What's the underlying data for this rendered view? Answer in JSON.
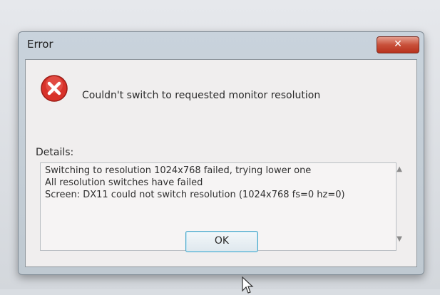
{
  "window": {
    "title": "Error",
    "close_label": "✕"
  },
  "dialog": {
    "message": "Couldn't switch to requested monitor resolution",
    "details_label": "Details:",
    "details_text": "Switching to resolution 1024x768 failed, trying lower one\nAll resolution switches have failed\nScreen: DX11 could not switch resolution (1024x768 fs=0 hz=0)",
    "ok_label": "OK"
  },
  "icons": {
    "error": "error-x-icon",
    "scroll_up": "scroll-up-arrow-icon",
    "scroll_down": "scroll-down-arrow-icon",
    "cursor": "mouse-cursor-icon"
  },
  "colors": {
    "close_button": "#c8503a",
    "error_icon": "#d8322a",
    "ok_border": "#4aa6c8"
  }
}
